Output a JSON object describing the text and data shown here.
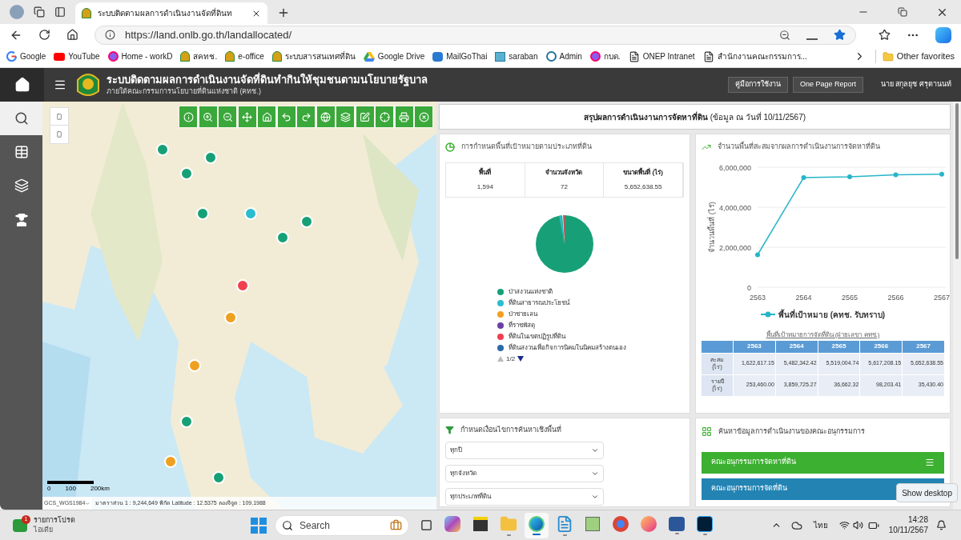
{
  "browser": {
    "tabs": [
      {
        "title": "ระบบติดตามผลการดำเนินงานจัดที่ดินท",
        "selected": true
      }
    ],
    "address": "https://land.onlb.go.th/landallocated/",
    "bookmarks": [
      {
        "label": "Google",
        "kind": "google"
      },
      {
        "label": "YouTube",
        "kind": "youtube"
      },
      {
        "label": "Home - workD",
        "kind": "round"
      },
      {
        "label": "สคทช.",
        "kind": "seal"
      },
      {
        "label": "e-office",
        "kind": "seal"
      },
      {
        "label": "ระบบสารสนเทศที่ดิน",
        "kind": "seal"
      },
      {
        "label": "Google Drive",
        "kind": "drive"
      },
      {
        "label": "MailGoThai",
        "kind": "mail"
      },
      {
        "label": "saraban",
        "kind": "doc"
      },
      {
        "label": "Admin",
        "kind": "wp"
      },
      {
        "label": "กบด.",
        "kind": "round"
      },
      {
        "label": "ONEP Intranet",
        "kind": "page"
      },
      {
        "label": "สำนักงานคณะกรรมการ...",
        "kind": "page"
      }
    ],
    "other_favorites": "Other favorites"
  },
  "header": {
    "title": "ระบบติดตามผลการดำเนินงานจัดที่ดินทำกินให้ชุมชนตามนโยบายรัฐบาล",
    "subtitle": "ภายใต้คณะกรรมการนโยบายที่ดินแห่งชาติ (คทช.)",
    "buttons": [
      "คู่มือการใช้งาน",
      "One Page Report"
    ],
    "user": "นาย สกุลยุช ศรุตานนท์"
  },
  "sidebar": {
    "items": [
      {
        "kind": "search",
        "selected": true
      },
      {
        "kind": "table",
        "selected": false
      },
      {
        "kind": "layers",
        "selected": false
      },
      {
        "kind": "farmer",
        "selected": false
      }
    ]
  },
  "map": {
    "scale_labels": [
      "0",
      "100",
      "200km"
    ],
    "projection": "GCS_WGS1984",
    "coordinates": "มาตราส่วน 1 : 9,244,649 พิกัด Latitude : 12.5375 ลองจิจูด : 109.1988"
  },
  "summary": {
    "title": "**สรุปผลการดำเนินงานการจัดหาที่ดิน** (ข้อมูล ณ วันที่ 10/11/2567)"
  },
  "land_type_card": {
    "title": "การกำหนดพื้นที่เป้าหมายตามประเภทที่ดิน",
    "stats": [
      {
        "label": "พื้นที่",
        "value": "1,594"
      },
      {
        "label": "จำนวนจังหวัด",
        "value": "72"
      },
      {
        "label": "ขนาดพื้นที่ (ไร่)",
        "value": "5,652,638.55"
      }
    ],
    "legend": [
      {
        "label": "ป่าสงวนแห่งชาติ",
        "color": "#17a077"
      },
      {
        "label": "ที่ดินสาธารณประโยชน์",
        "color": "#2bbcd0"
      },
      {
        "label": "ป่าชายเลน",
        "color": "#f0a020"
      },
      {
        "label": "ที่ราชพัสดุ",
        "color": "#6a3fa0"
      },
      {
        "label": "ที่ดินในเขตปฏิรูปที่ดิน",
        "color": "#f04050"
      },
      {
        "label": "ที่ดินสงวนเพื่อกิจการนิคมในนิคมสร้างตนเอง",
        "color": "#2a6aa8"
      }
    ],
    "pager": {
      "text": "1/2",
      "prev_disabled": true,
      "next_disabled": false
    }
  },
  "trend_card": {
    "title": "จำนวนพื้นที่สะสมจากผลการดำเนินงานการจัดหาที่ดิน",
    "chart_data": {
      "type": "line",
      "ylabel": "จำนวนพื้นที่ (ไร่)",
      "categories": [
        "2563",
        "2564",
        "2565",
        "2566",
        "2567"
      ],
      "series": [
        {
          "name": "พื้นที่เป้าหมาย (คทช. รับทราบ)",
          "color": "#26b5c8",
          "marker": true,
          "values": [
            1620000,
            5480000,
            5520000,
            5620000,
            5650000
          ]
        }
      ],
      "ylim": [
        0,
        6000000
      ],
      "yticks": [
        0,
        {
          "value": 2000000,
          "label": "2,000,000"
        },
        {
          "value": 4000000,
          "label": "4,000,000"
        },
        {
          "value": 6000000,
          "label": "6,000,000"
        }
      ]
    },
    "table": {
      "caption": "พื้นที่เป้าหมายการจัดที่ดิน (ฝ่ายเลขา คทช.)",
      "columns": [
        "2563",
        "2564",
        "2565",
        "2566",
        "2567"
      ],
      "rows": [
        {
          "label": "สะสม",
          "unit": "(ไร่)",
          "cells": [
            "1,622,617.15",
            "5,482,342.42",
            "5,519,004.74",
            "5,617,208.15",
            "5,652,638.55"
          ]
        },
        {
          "label": "รายปี",
          "unit": "(ไร่)",
          "cells": [
            "253,460.00",
            "3,859,725.27",
            "36,662.32",
            "98,203.41",
            "35,430.40"
          ]
        }
      ]
    }
  },
  "filter_card": {
    "title": "กำหนดเงื่อนไขการค้นหาเชิงพื้นที่",
    "selects": [
      "ทุกปี",
      "ทุกจังหวัด",
      "ทุกประเภทที่ดิน"
    ]
  },
  "committee_card": {
    "title": "ค้นหาข้อมูลการดำเนินงานของคณะอนุกรรมการ",
    "buttons": [
      {
        "label": "คณะอนุกรรมการจัดหาที่ดิน",
        "color": "#3cb030",
        "menu_icon": true
      },
      {
        "label": "คณะอนุกรรมการจัดที่ดิน",
        "color": "#2384b4",
        "menu_icon": false
      }
    ]
  },
  "tooltip": "Show desktop",
  "taskbar": {
    "widget": {
      "title": "รายการโปรด",
      "subtitle": "ไอเดีย",
      "badge": "1"
    },
    "search": "Search",
    "apps": [
      {
        "kind": "copilot",
        "open": false,
        "selected": false
      },
      {
        "kind": "notes",
        "open": false,
        "selected": false
      },
      {
        "kind": "folder",
        "open": true,
        "selected": false
      },
      {
        "kind": "edge",
        "open": true,
        "selected": true
      },
      {
        "kind": "notepad",
        "open": true,
        "selected": false
      },
      {
        "kind": "paint",
        "open": false,
        "selected": false
      },
      {
        "kind": "chrome",
        "open": false,
        "selected": false
      },
      {
        "kind": "firefox",
        "open": false,
        "selected": false
      },
      {
        "kind": "word",
        "open": true,
        "selected": false
      },
      {
        "kind": "ps",
        "open": true,
        "selected": false
      }
    ],
    "language": "ไทย",
    "time": "14:28",
    "date": "10/11/2567"
  }
}
